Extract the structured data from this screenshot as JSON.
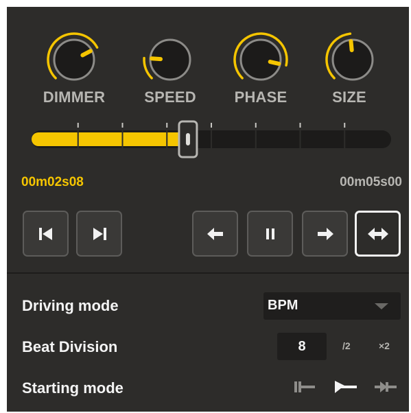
{
  "colors": {
    "accent": "#f5c500",
    "panel_bg": "#2d2c2a",
    "label_gray": "#b7b6b2",
    "text_white": "#f4f4f4"
  },
  "knobs": [
    {
      "label": "DIMMER",
      "value": 0.73
    },
    {
      "label": "SPEED",
      "value": 0.18
    },
    {
      "label": "PHASE",
      "value": 0.88
    },
    {
      "label": "SIZE",
      "value": 0.48
    }
  ],
  "timeline": {
    "segments": 8,
    "position": 0.435,
    "current_time": "00m02s08",
    "total_time": "00m05s00"
  },
  "transport": {
    "icons": [
      "skip-to-start-icon",
      "skip-to-end-icon",
      "arrow-left-icon",
      "pause-icon",
      "arrow-right-icon",
      "arrows-left-right-icon"
    ],
    "active": "arrows-left-right-icon"
  },
  "settings": {
    "driving_mode_label": "Driving mode",
    "driving_mode_value": "BPM",
    "beat_division_label": "Beat Division",
    "beat_division_value": "8",
    "halve_label": "/2",
    "double_label": "×2",
    "starting_mode_label": "Starting mode",
    "starting_mode_icons": [
      "start-left-icon",
      "start-center-icon",
      "start-right-icon"
    ],
    "starting_mode_selected": "start-center-icon"
  }
}
